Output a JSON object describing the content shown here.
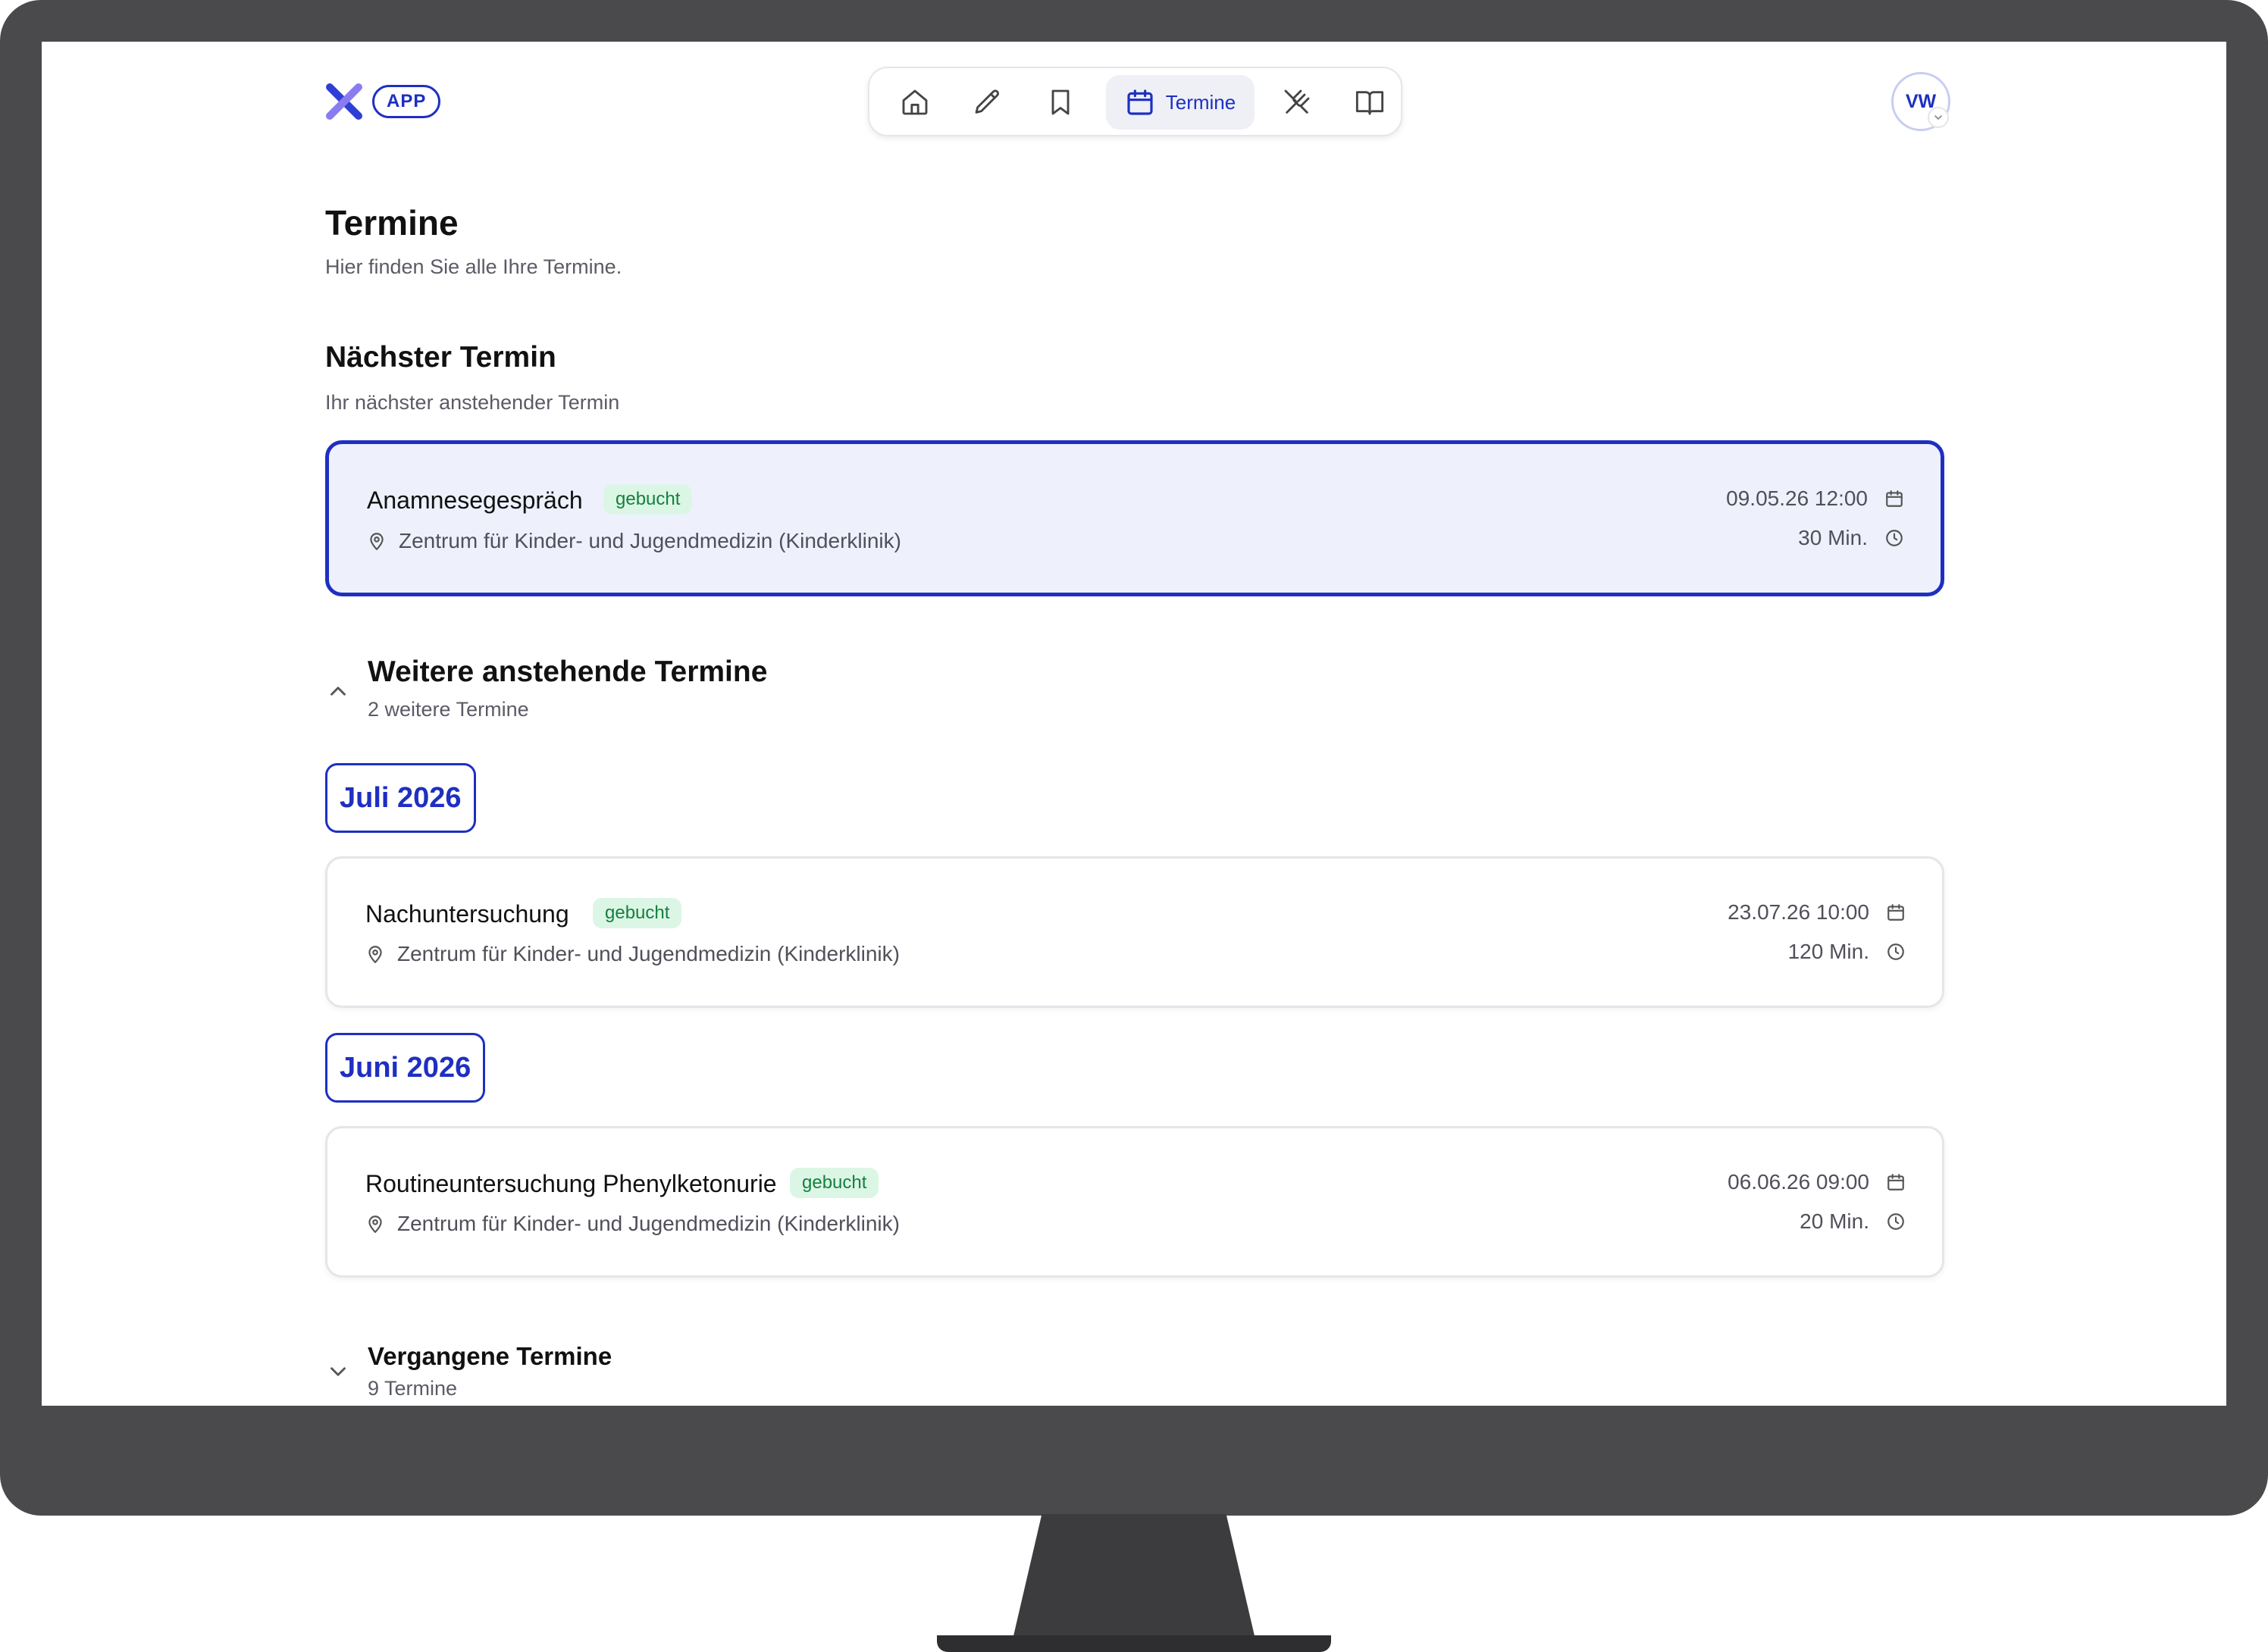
{
  "header": {
    "app_badge": "APP",
    "nav": {
      "home": "home-icon",
      "edit": "pencil-icon",
      "saved": "bookmark-icon",
      "appointments": "Termine",
      "nutrition": "utensils-crossed-icon",
      "library": "book-open-icon"
    },
    "user_initials": "VW"
  },
  "page": {
    "title": "Termine",
    "subtitle": "Hier finden Sie alle Ihre Termine."
  },
  "next": {
    "heading": "Nächster Termin",
    "subheading": "Ihr nächster anstehender Termin",
    "appointment": {
      "title": "Anamnesegespräch",
      "status": "gebucht",
      "location": "Zentrum für Kinder- und Jugendmedizin (Kinderklinik)",
      "datetime": "09.05.26 12:00",
      "duration": "30 Min."
    }
  },
  "upcoming": {
    "heading": "Weitere anstehende Termine",
    "count": "2 weitere Termine",
    "groups": [
      {
        "month": "Juli 2026",
        "appointment": {
          "title": "Nachuntersuchung",
          "status": "gebucht",
          "location": "Zentrum für Kinder- und Jugendmedizin (Kinderklinik)",
          "datetime": "23.07.26 10:00",
          "duration": "120 Min."
        }
      },
      {
        "month": "Juni 2026",
        "appointment": {
          "title": "Routineuntersuchung Phenylketonurie",
          "status": "gebucht",
          "location": "Zentrum für Kinder- und Jugendmedizin (Kinderklinik)",
          "datetime": "06.06.26 09:00",
          "duration": "20 Min."
        }
      }
    ]
  },
  "past": {
    "heading": "Vergangene Termine",
    "count": "9 Termine"
  },
  "colors": {
    "accent": "#1e2fc2",
    "next_card_bg": "#eef1fc",
    "badge_bg": "#dcf6e6",
    "badge_text": "#15803d",
    "frame": "#4a4a4c"
  }
}
